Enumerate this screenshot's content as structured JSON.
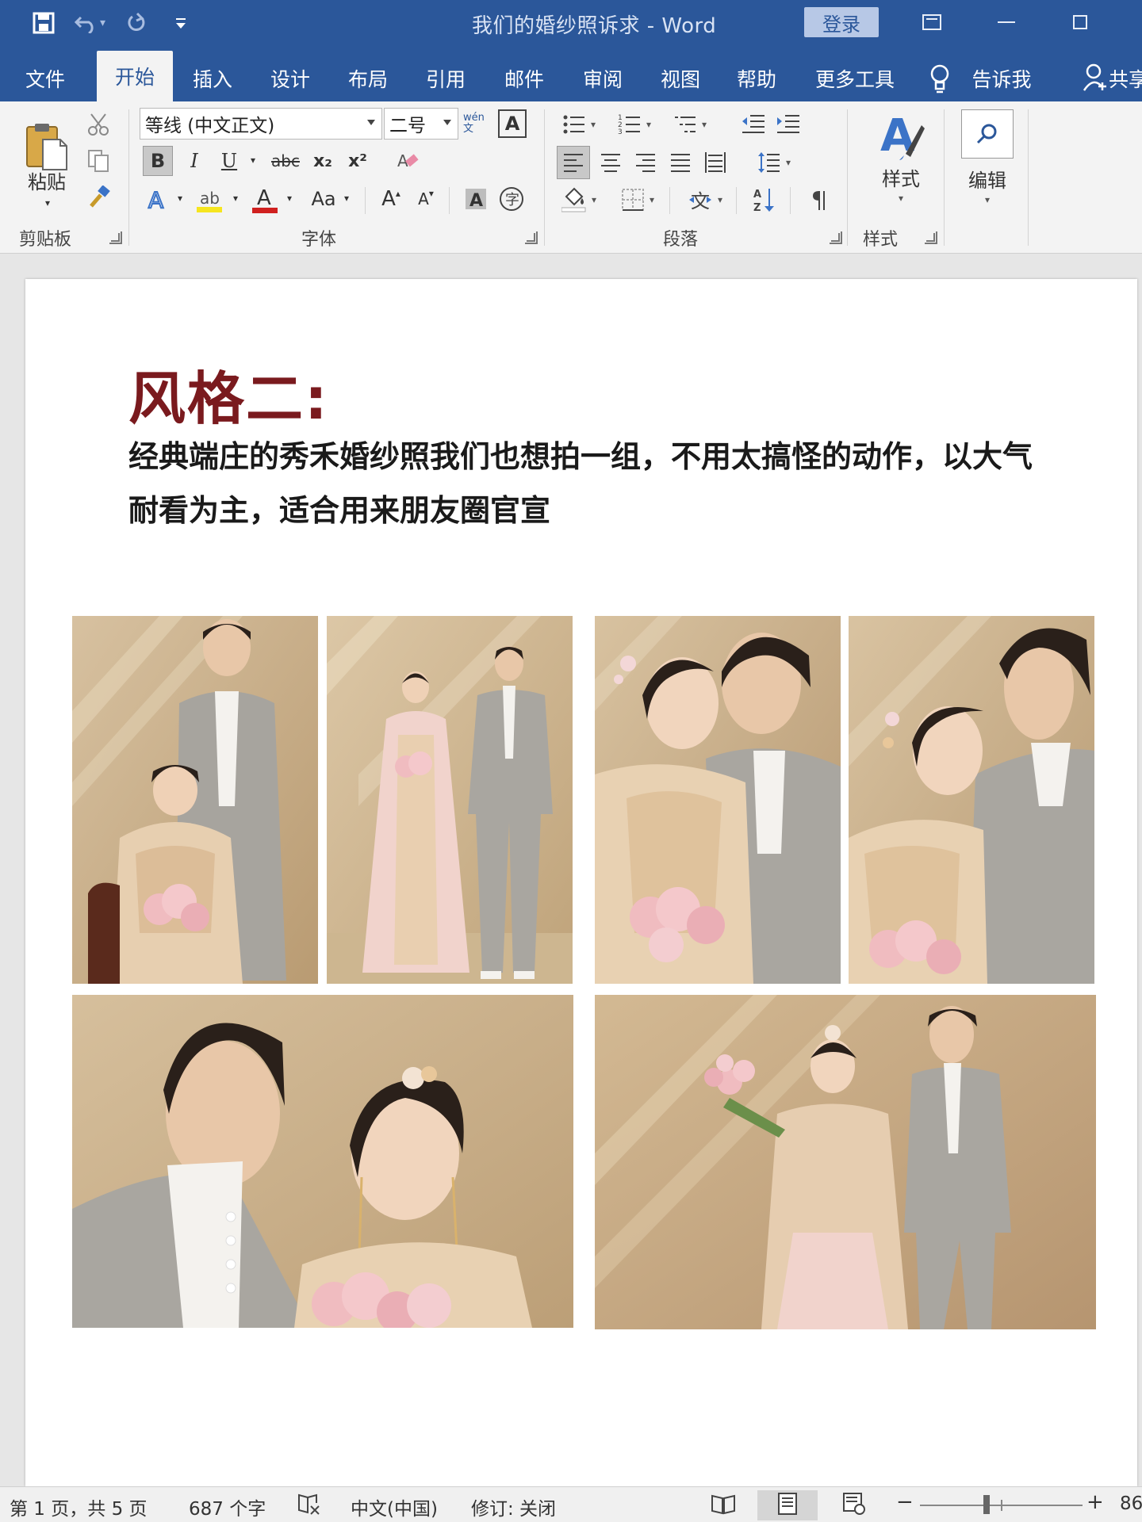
{
  "window": {
    "title": "我们的婚纱照诉求  -  Word",
    "login_label": "登录"
  },
  "tabs": [
    "文件",
    "开始",
    "插入",
    "设计",
    "布局",
    "引用",
    "邮件",
    "审阅",
    "视图",
    "帮助",
    "更多工具"
  ],
  "active_tab": "开始",
  "tell_me": "告诉我",
  "share": "共享",
  "ribbon": {
    "clipboard": {
      "paste_label": "粘贴",
      "group_label": "剪贴板"
    },
    "font": {
      "font_name": "等线 (中文正文)",
      "font_size": "二号",
      "phonetic_label": "wén文",
      "bold": "B",
      "italic": "I",
      "underline": "U",
      "strike": "abc",
      "subscript": "x₂",
      "superscript": "x²",
      "case_label": "Aa",
      "grow_label": "A",
      "shrink_label": "A",
      "font_color": "#d0201f",
      "highlight_color": "#f6e51f",
      "group_label": "字体"
    },
    "paragraph": {
      "group_label": "段落"
    },
    "styles": {
      "big_label": "样式",
      "group_label": "样式"
    },
    "editing": {
      "big_label": "编辑"
    }
  },
  "document": {
    "heading": "风格二:",
    "body": "经典端庄的秀禾婚纱照我们也想拍一组，不用太搞怪的动作，以大气耐看为主，适合用来朋友圈官宣",
    "heading_color": "#7a1a1e",
    "photos": [
      {
        "name": "photo-couple-seated-bride"
      },
      {
        "name": "photo-couple-full-length"
      },
      {
        "name": "photo-couple-nose-touch"
      },
      {
        "name": "photo-couple-forehead-kiss"
      },
      {
        "name": "photo-couple-closeup-smile"
      },
      {
        "name": "photo-couple-bouquet-raised"
      }
    ]
  },
  "status": {
    "page": "第 1 页，共 5 页",
    "words": "687 个字",
    "language": "中文(中国)",
    "track_changes": "修订: 关闭",
    "zoom": "86"
  },
  "colors": {
    "accent": "#2b579a",
    "ribbon_bg": "#f3f3f3"
  }
}
